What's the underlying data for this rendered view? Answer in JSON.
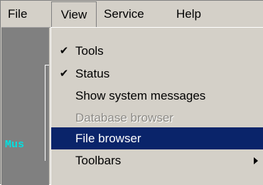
{
  "menubar": {
    "items": [
      {
        "label": "File"
      },
      {
        "label": "View"
      },
      {
        "label": "Service"
      },
      {
        "label": "Help"
      }
    ]
  },
  "background": {
    "label_fragment": "Mus",
    "label_color": "#00e0e0"
  },
  "view_menu": {
    "items": [
      {
        "label": "Tools",
        "checked": true,
        "enabled": true
      },
      {
        "label": "Status",
        "checked": true,
        "enabled": true
      },
      {
        "label": "Show system messages",
        "checked": false,
        "enabled": true
      },
      {
        "label": "Database browser",
        "checked": false,
        "enabled": false
      },
      {
        "label": "File browser",
        "checked": false,
        "enabled": true,
        "highlighted": true
      },
      {
        "label": "Toolbars",
        "checked": false,
        "enabled": true,
        "submenu": true
      }
    ],
    "check_glyph": "✔",
    "highlight_color": "#0a246a"
  }
}
